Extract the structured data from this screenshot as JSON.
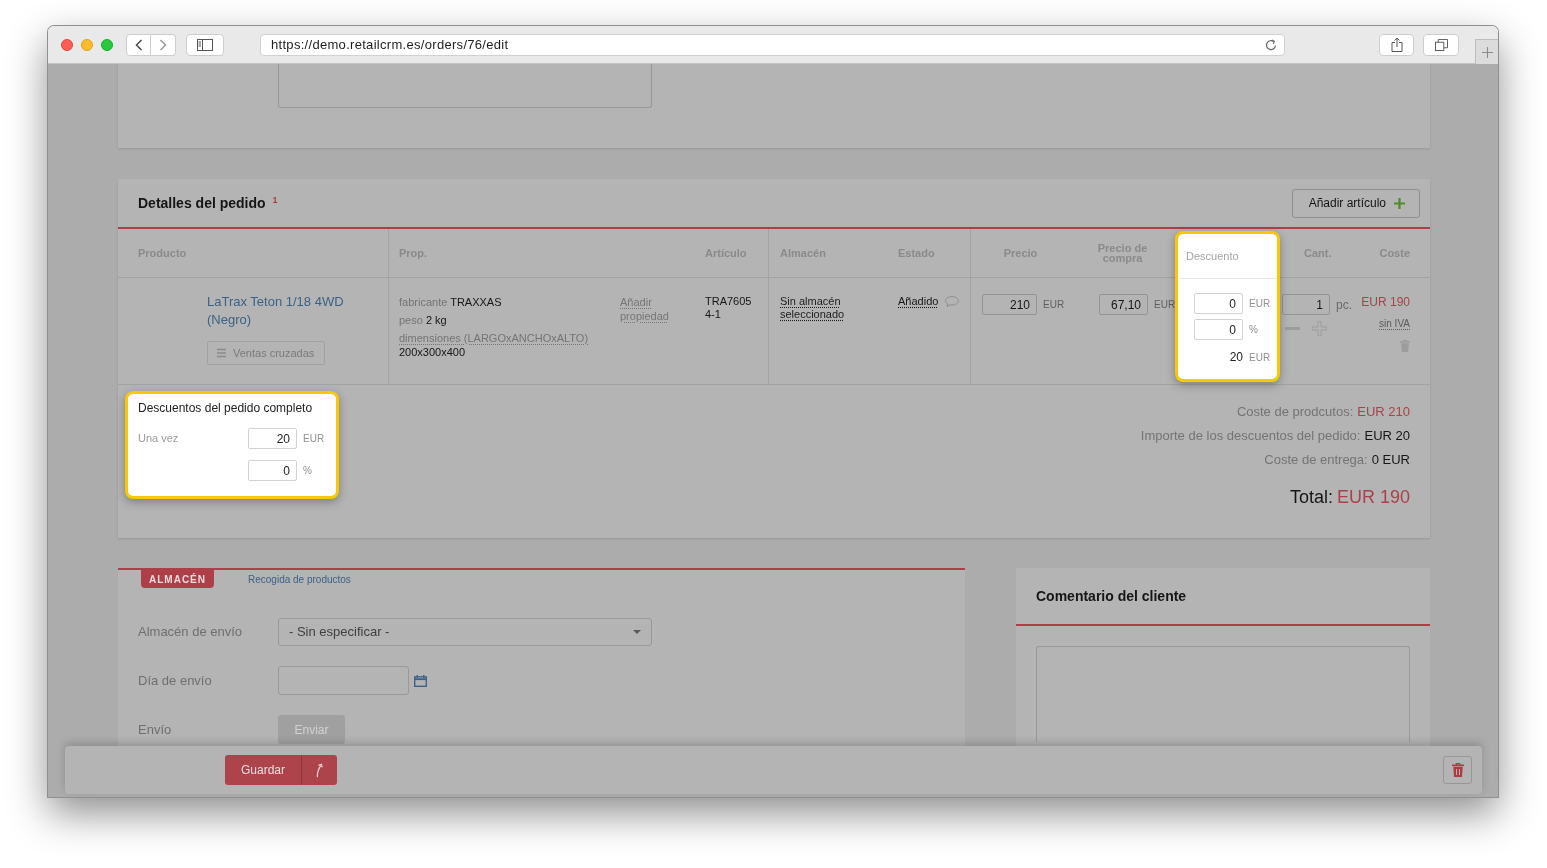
{
  "browser": {
    "url": "https://demo.retailcrm.es/orders/76/edit"
  },
  "order_details": {
    "title": "Detalles del pedido $^{1}$",
    "add_button": "Añadir artículo",
    "columns": [
      {
        "label": "Producto",
        "highlighted": false
      },
      {
        "label": "Prop.",
        "highlighted": false
      },
      {
        "label": "Artículo",
        "highlighted": false
      },
      {
        "label": "Almacén",
        "highlighted": false
      },
      {
        "label": "Estado",
        "highlighted": false
      },
      {
        "label": "Precio",
        "highlighted": false
      },
      {
        "label": "Precio de compra",
        "highlighted": false
      },
      {
        "label": "Descuento",
        "highlighted": true
      },
      {
        "label": "Cant.",
        "highlighted": false
      },
      {
        "label": "Coste",
        "highlighted": false
      }
    ],
    "items": [
      {
        "product": "LaTrax Teton 1/18 4WD (Negro)",
        "cross_sell_button": "Ventas cruzadas",
        "properties": [
          {
            "name": "fabricante",
            "value": "TRAXXAS",
            "underlined": false
          },
          {
            "name": "peso",
            "value": "2 kg",
            "underlined": false
          },
          {
            "name": "dimensiones (LARGOxANCHOxALTO)",
            "value": "200x300x400",
            "underlined": true
          }
        ],
        "add_property": "Añadir propiedad",
        "article": "TRA7605 4-1",
        "warehouse": "Sin almacén seleccionado",
        "status": "Añadido",
        "price": "210",
        "price_unit": "EUR",
        "purchase_price": "67,10",
        "purchase_unit": "EUR",
        "discount": {
          "amount": "0",
          "amount_unit": "EUR",
          "percent": "0",
          "percent_unit": "%",
          "total": "20",
          "total_unit": "EUR"
        },
        "quantity": "1",
        "quantity_unit": "pc.",
        "cost": "EUR 190",
        "vat_note": "sin IVA"
      }
    ]
  },
  "order_discount": {
    "title": "Descuentos del pedido completo",
    "highlighted": true,
    "label": "Una vez",
    "amount": "20",
    "amount_unit": "EUR",
    "percent": "0",
    "percent_unit": "%"
  },
  "totals": [
    {
      "label": "Coste de prodcutos:",
      "value": "EUR 210",
      "kind": "accent"
    },
    {
      "label": "Importe de los descuentos del pedido:",
      "value": "EUR 20",
      "kind": "plain"
    },
    {
      "label": "Coste de entrega:",
      "value": "0 EUR",
      "kind": "plain"
    }
  ],
  "total": {
    "label": "Total:",
    "value": "EUR 190"
  },
  "shipping": {
    "tabs": [
      {
        "label": "ALMACÉN",
        "selected": true
      },
      {
        "label": "Recogida de productos",
        "selected": false
      }
    ],
    "fields": [
      {
        "label": "Almacén de envío",
        "kind": "select",
        "value": "- Sin especificar -"
      },
      {
        "label": "Día de envío",
        "kind": "date"
      },
      {
        "label": "Envío",
        "kind": "button",
        "button": "Enviar",
        "disabled": true
      }
    ]
  },
  "customer_comment": {
    "title": "Comentario del cliente"
  },
  "footer": {
    "save_button": "Guardar"
  }
}
